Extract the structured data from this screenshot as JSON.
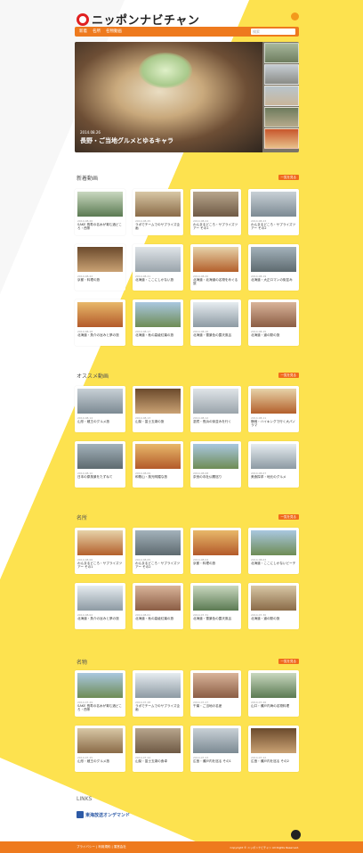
{
  "site": {
    "logo_text": "ニッポンナビチャン",
    "nav": [
      "新着",
      "名所",
      "名物動画"
    ],
    "search_placeholder": "検索"
  },
  "hero": {
    "date": "2014.08.26",
    "title": "長野・ご当地グルメとゆるキャラ"
  },
  "sections": [
    {
      "key": "new",
      "title": "新着動画",
      "more": "一覧を見る",
      "cards": [
        {
          "date": "2014.08.26",
          "title": "SAKE 長寿の名水が育む酒どころ・西条"
        },
        {
          "date": "2014.08.25",
          "title": "ラボでチームでのサプライズ企画"
        },
        {
          "date": "2014.08.24",
          "title": "わんまるどころ・サプライズツアー その1"
        },
        {
          "date": "2014.08.23",
          "title": "わんまるどころ・サプライズツアー その2"
        },
        {
          "date": "2014.08.22",
          "title": "京都・料理の旅"
        },
        {
          "date": "2014.08.21",
          "title": "北海道・ここにしかない旅"
        },
        {
          "date": "2014.08.20",
          "title": "北海道・北海道の名物をめぐる旅"
        },
        {
          "date": "2014.08.19",
          "title": "北海道・大正ロマンの街並み"
        },
        {
          "date": "2014.08.18",
          "title": "北海道・魚介の旨みと夢の旅"
        },
        {
          "date": "2014.08.17",
          "title": "北海道・秋の高級紅葉の旅"
        },
        {
          "date": "2014.08.16",
          "title": "北海道・雪景色の露天風呂"
        },
        {
          "date": "2014.08.15",
          "title": "北海道・道の駅の旅"
        }
      ]
    },
    {
      "key": "recommend",
      "title": "オススメ動画",
      "more": "一覧を見る",
      "cards": [
        {
          "date": "2014.08.14",
          "title": "山形・蔵王のグルメ旅"
        },
        {
          "date": "2014.08.13",
          "title": "山梨・富士五湖の旅"
        },
        {
          "date": "2014.08.12",
          "title": "滋賀・長浜の街並みを行く"
        },
        {
          "date": "2014.08.11",
          "title": "静岡・ハイキングで行く大パノラマ"
        },
        {
          "date": "2014.08.10",
          "title": "日本の原風景をたずねて"
        },
        {
          "date": "2014.08.09",
          "title": "和歌山・風光明媚な旅"
        },
        {
          "date": "2014.08.08",
          "title": "奈良の寺社仏閣巡り"
        },
        {
          "date": "2014.08.07",
          "title": "美食探求・地元のグルメ"
        }
      ]
    },
    {
      "key": "famous",
      "title": "名所",
      "more": "一覧を見る",
      "cards": [
        {
          "date": "2014.08.06",
          "title": "わんまるどころ・サプライズツアー その1"
        },
        {
          "date": "2014.08.05",
          "title": "わんまるどころ・サプライズツアー その2"
        },
        {
          "date": "2014.08.04",
          "title": "京都・料理の旅"
        },
        {
          "date": "2014.08.03",
          "title": "北海道・ここにしかないビーチ"
        },
        {
          "date": "2014.08.02",
          "title": "北海道・魚介の旨みと夢の旅"
        },
        {
          "date": "2014.08.01",
          "title": "北海道・秋の高級紅葉の旅"
        },
        {
          "date": "2014.07.31",
          "title": "北海道・雪景色の露天風呂"
        },
        {
          "date": "2014.07.30",
          "title": "北海道・道の駅の旅"
        }
      ]
    },
    {
      "key": "specialty",
      "title": "名物",
      "more": "一覧を見る",
      "cards": [
        {
          "date": "2014.07.29",
          "title": "SAKE 長寿の名水が育む酒どころ・西条"
        },
        {
          "date": "2014.07.28",
          "title": "ラボでチームでのサプライズ企画"
        },
        {
          "date": "2014.07.27",
          "title": "千葉・ご当地の名産"
        },
        {
          "date": "2014.07.26",
          "title": "山口・瀬戸内海の名物料理"
        },
        {
          "date": "2014.07.25",
          "title": "山形・蔵王のグルメ旅"
        },
        {
          "date": "2014.07.24",
          "title": "山梨・富士五湖の食卓"
        },
        {
          "date": "2014.07.23",
          "title": "広島・瀬戸内を巡る その1"
        },
        {
          "date": "2014.07.22",
          "title": "広島・瀬戸内を巡る その2"
        }
      ]
    }
  ],
  "links": {
    "title": "LINKS",
    "banner": "東海放送オンデマンド"
  },
  "footer": {
    "links": "プライバシー | 利用規約 | 運営会社",
    "copyright": "Copyright © ニッポンナビチャン All Rights Reserved."
  },
  "colors": {
    "accent": "#ee7a1e",
    "background": "#fde24f",
    "more_button": "#f06a1c"
  }
}
